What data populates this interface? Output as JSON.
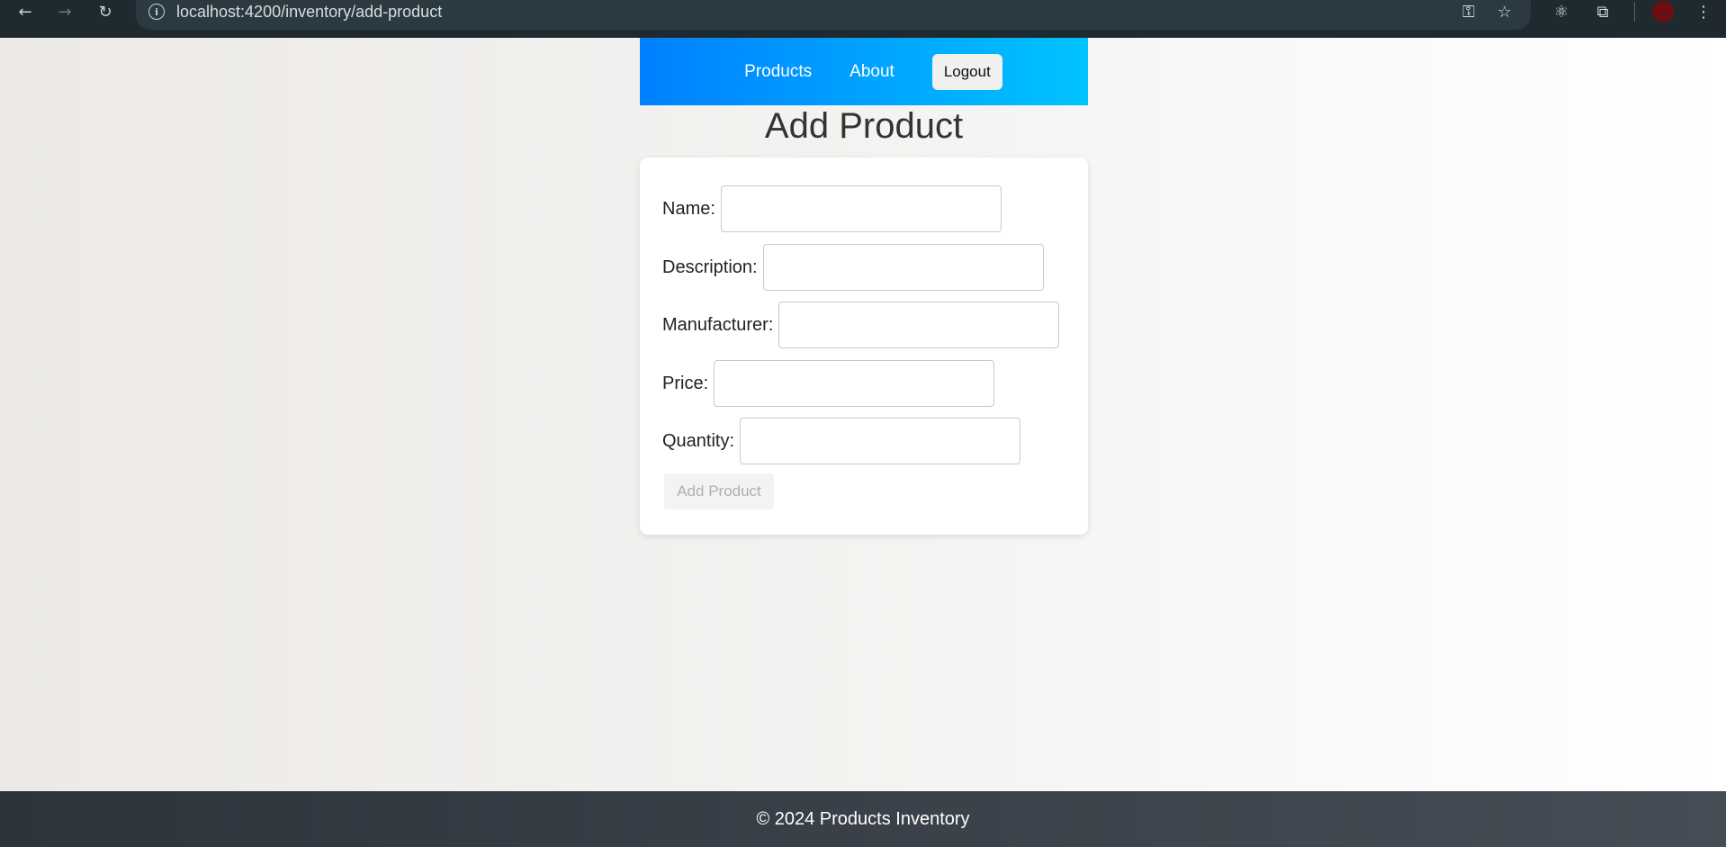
{
  "browser": {
    "url": "localhost:4200/inventory/add-product",
    "info_glyph": "i",
    "back_glyph": "←",
    "forward_glyph": "→",
    "reload_glyph": "↻",
    "key_glyph": "⚿",
    "star_glyph": "☆",
    "react_glyph": "⚛",
    "extensions_glyph": "⧉",
    "menu_glyph": "⋮"
  },
  "header": {
    "nav": [
      {
        "label": "Products"
      },
      {
        "label": "About"
      }
    ],
    "logout_label": "Logout",
    "gradient": [
      "#0080ff",
      "#00c3ff"
    ]
  },
  "page": {
    "title": "Add Product"
  },
  "form": {
    "fields": [
      {
        "label": "Name:",
        "value": ""
      },
      {
        "label": "Description:",
        "value": ""
      },
      {
        "label": "Manufacturer:",
        "value": ""
      },
      {
        "label": "Price:",
        "value": ""
      },
      {
        "label": "Quantity:",
        "value": ""
      }
    ],
    "submit_label": "Add Product",
    "submit_disabled": true
  },
  "footer": {
    "text": "© 2024 Products Inventory"
  }
}
